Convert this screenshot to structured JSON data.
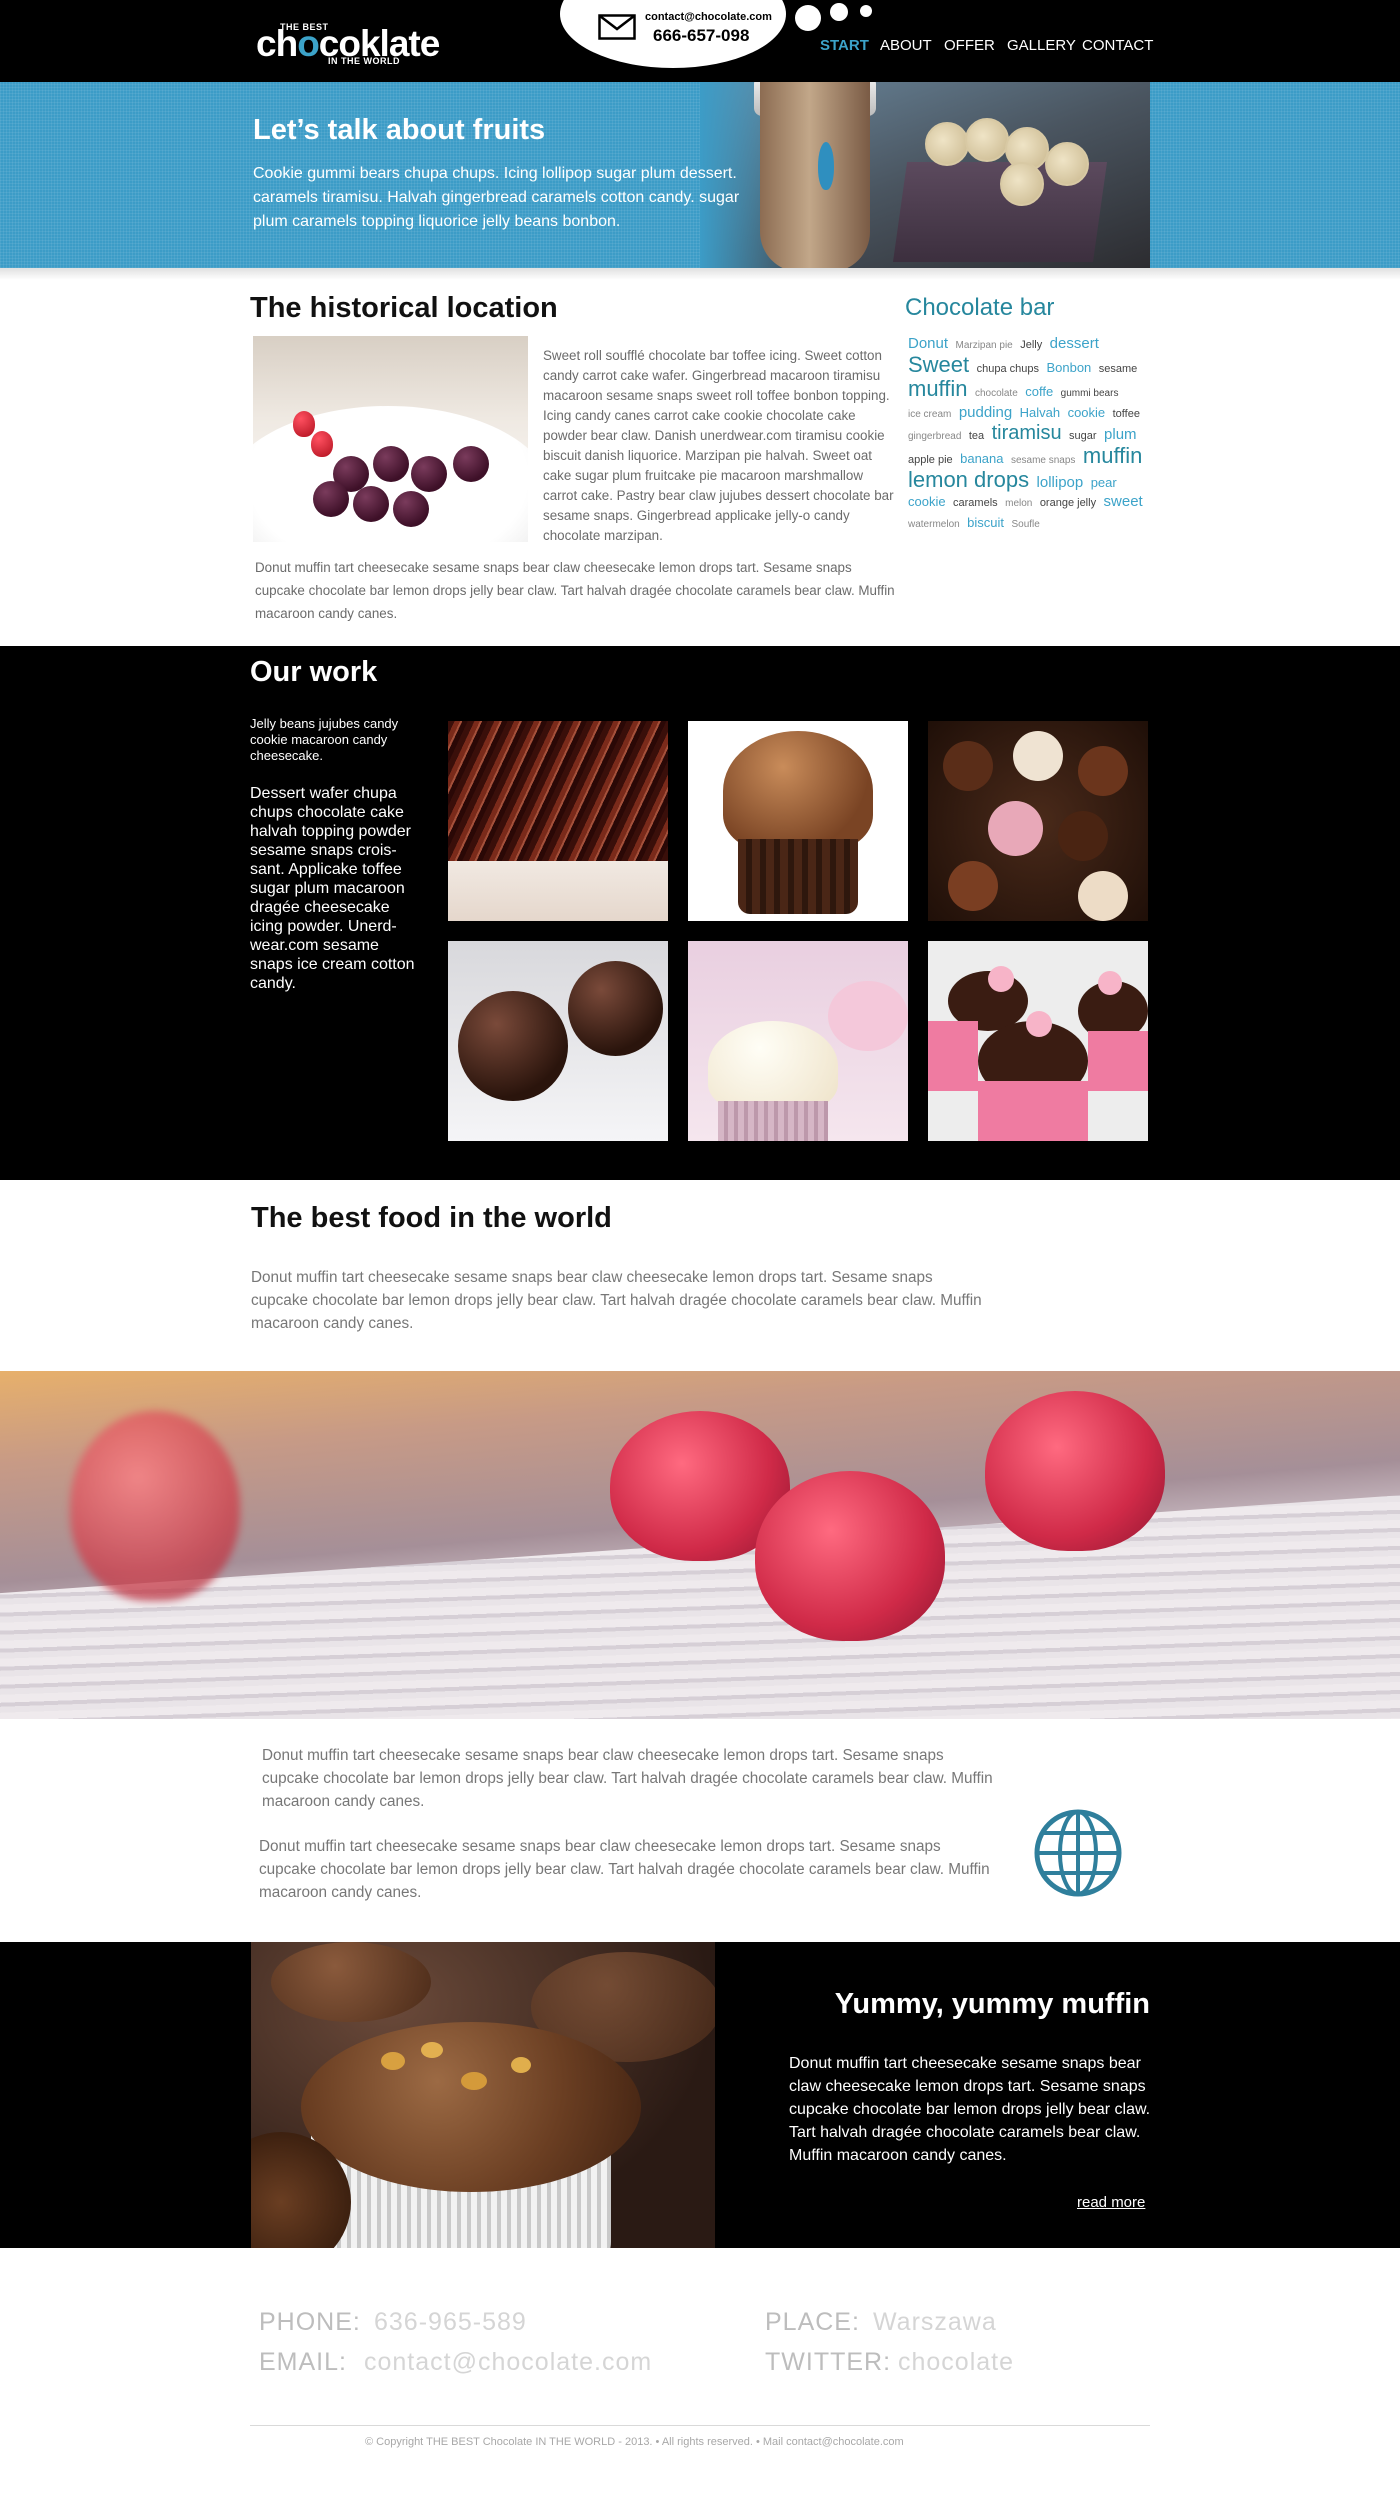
{
  "header": {
    "logo_top": "THE BEST",
    "logo_main_a": "ch",
    "logo_main_o": "o",
    "logo_main_b": "coklate",
    "logo_bottom": "IN THE WORLD",
    "email": "contact@chocolate.com",
    "phone": "666-657-098",
    "nav": [
      "START",
      "ABOUT",
      "OFFER",
      "GALLERY",
      "CONTACT"
    ],
    "accent_color": "#3ca3c9"
  },
  "hero": {
    "title": "Let’s talk about fruits",
    "text": "Cookie gummi bears chupa chups. Icing lollipop sugar plum dessert. caramels tiramisu. Halvah gingerbread caramels cotton candy. sugar plum caramels topping liquorice jelly beans bonbon."
  },
  "historical": {
    "title": "The historical location",
    "text": "Sweet roll soufflé chocolate bar toffee icing. Sweet cotton candy carrot cake wafer. Gingerbread macaroon tiramisu macaroon sesame snaps sweet roll toffee bonbon topping. Icing candy canes carrot cake cookie chocolate cake powder bear claw. Danish unerdwear.com tiramisu cookie biscuit danish liquorice. Marzipan pie halvah. Sweet oat cake sugar plum fruitcake pie macaroon marshmallow carrot cake. Pastry bear claw jujubes dessert chocolate bar sesame snaps. Gingerbread applicake jelly-o candy chocolate marzipan.",
    "text2": "Donut muffin tart cheesecake sesame snaps bear claw cheesecake lemon drops tart. Sesame snaps cupcake chocolate bar lemon drops jelly bear claw. Tart halvah dragée chocolate caramels bear claw. Muffin macaroon candy canes."
  },
  "cloud": {
    "title": "Chocolate bar",
    "tags": [
      {
        "t": "Donut",
        "s": 15,
        "c": "#3ca3c9"
      },
      {
        "t": "Marzipan pie",
        "s": 10,
        "c": "#888"
      },
      {
        "t": "Jelly",
        "s": 11,
        "c": "#444"
      },
      {
        "t": "dessert",
        "s": 15,
        "c": "#3ca3c9"
      },
      {
        "t": "Sweet",
        "s": 22,
        "c": "#26879d"
      },
      {
        "t": "chupa chups",
        "s": 11,
        "c": "#444"
      },
      {
        "t": "Bonbon",
        "s": 13,
        "c": "#3ca3c9"
      },
      {
        "t": "sesame",
        "s": 11,
        "c": "#444"
      },
      {
        "t": "muffin",
        "s": 22,
        "c": "#26879d"
      },
      {
        "t": "chocolate",
        "s": 10,
        "c": "#888"
      },
      {
        "t": "coffe",
        "s": 13,
        "c": "#3ca3c9"
      },
      {
        "t": "gummi bears",
        "s": 10,
        "c": "#444"
      },
      {
        "t": "ice cream",
        "s": 10,
        "c": "#888"
      },
      {
        "t": "pudding",
        "s": 15,
        "c": "#3ca3c9"
      },
      {
        "t": "Halvah",
        "s": 13,
        "c": "#3ca3c9"
      },
      {
        "t": "cookie",
        "s": 13,
        "c": "#3ca3c9"
      },
      {
        "t": "toffee",
        "s": 11,
        "c": "#444"
      },
      {
        "t": "gingerbread",
        "s": 10,
        "c": "#888"
      },
      {
        "t": "tea",
        "s": 11,
        "c": "#444"
      },
      {
        "t": "tiramisu",
        "s": 20,
        "c": "#26879d"
      },
      {
        "t": "sugar",
        "s": 11,
        "c": "#444"
      },
      {
        "t": "plum",
        "s": 15,
        "c": "#3ca3c9"
      },
      {
        "t": "apple pie",
        "s": 11,
        "c": "#444"
      },
      {
        "t": "banana",
        "s": 13,
        "c": "#3ca3c9"
      },
      {
        "t": "sesame snaps",
        "s": 10,
        "c": "#888"
      },
      {
        "t": "muffin",
        "s": 22,
        "c": "#26879d"
      },
      {
        "t": "lemon drops",
        "s": 22,
        "c": "#26879d"
      },
      {
        "t": "lollipop",
        "s": 15,
        "c": "#3ca3c9"
      },
      {
        "t": "pear",
        "s": 13,
        "c": "#3ca3c9"
      },
      {
        "t": "cookie",
        "s": 13,
        "c": "#3ca3c9"
      },
      {
        "t": "caramels",
        "s": 11,
        "c": "#444"
      },
      {
        "t": "melon",
        "s": 10,
        "c": "#888"
      },
      {
        "t": "orange jelly",
        "s": 11,
        "c": "#444"
      },
      {
        "t": "sweet",
        "s": 15,
        "c": "#3ca3c9"
      },
      {
        "t": "watermelon",
        "s": 10,
        "c": "#888"
      },
      {
        "t": "biscuit",
        "s": 13,
        "c": "#3ca3c9"
      },
      {
        "t": "Soufle",
        "s": 10,
        "c": "#888"
      }
    ]
  },
  "work": {
    "title": "Our work",
    "small": "Jelly beans jujubes candy cookie macaroon candy cheesecake.",
    "text": "Dessert wafer chupa chups chocolate cake halvah topping powder sesame snaps crois-sant. Applicake toffee sugar plum macaroon dragée cheesecake icing powder. Unerd-wear.com sesame snaps ice cream cotton candy."
  },
  "best_food": {
    "title": "The best food in the world",
    "text": "Donut muffin tart cheesecake sesame snaps bear claw cheesecake lemon drops tart. Sesame snaps cupcake chocolate bar lemon drops jelly bear claw. Tart halvah dragée chocolate caramels bear claw. Muffin macaroon candy canes."
  },
  "globe_section": {
    "text1": "Donut muffin tart cheesecake sesame snaps bear claw cheesecake lemon drops tart. Sesame snaps cupcake chocolate bar lemon drops jelly bear claw. Tart halvah dragée chocolate caramels bear claw. Muffin macaroon candy canes.",
    "text2": "Donut muffin tart cheesecake sesame snaps bear claw cheesecake lemon drops tart. Sesame snaps cupcake chocolate bar lemon drops jelly bear claw. Tart halvah dragée chocolate caramels bear claw. Muffin macaroon candy canes.",
    "icon": "globe-icon"
  },
  "muffin": {
    "title": "Yummy, yummy muffin",
    "text": "Donut muffin tart cheesecake sesame snaps bear claw cheesecake lemon drops tart. Sesame snaps cupcake chocolate bar lemon drops jelly bear claw. Tart halvah dragée chocolate caramels bear claw. Muffin macaroon candy canes.",
    "read_more": "read more"
  },
  "footer": {
    "phone_label": "PHONE:",
    "phone_value": "636-965-589",
    "email_label": "EMAIL:",
    "email_value": "contact@chocolate.com",
    "place_label": "PLACE:",
    "place_value": "Warszawa",
    "twitter_label": "TWITTER:",
    "twitter_value": "chocolate",
    "copyright": "© Copyright THE BEST Chocolate IN THE WORLD - 2013. • All rights reserved. • Mail contact@chocolate.com"
  }
}
